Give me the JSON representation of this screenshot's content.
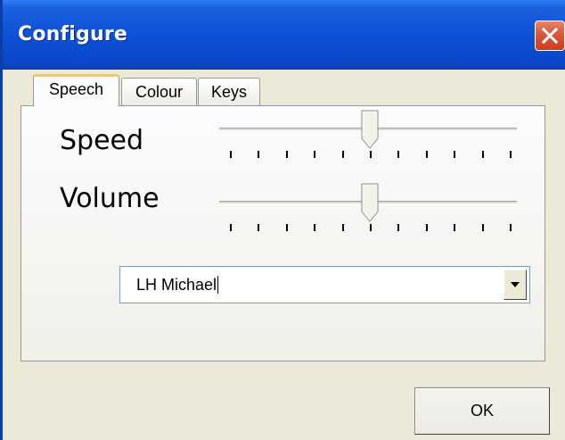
{
  "window": {
    "title": "Configure",
    "close_icon": "close-icon"
  },
  "tabs": [
    {
      "label": "Speech",
      "active": true
    },
    {
      "label": "Colour",
      "active": false
    },
    {
      "label": "Keys",
      "active": false
    }
  ],
  "speech": {
    "speed": {
      "label": "Speed",
      "value_fraction": 0.5,
      "tick_count": 11
    },
    "volume": {
      "label": "Volume",
      "value_fraction": 0.5,
      "tick_count": 11
    },
    "voice": {
      "selected": "LH Michael",
      "dropdown_icon": "chevron-down-icon"
    }
  },
  "buttons": {
    "ok_label": "OK"
  }
}
